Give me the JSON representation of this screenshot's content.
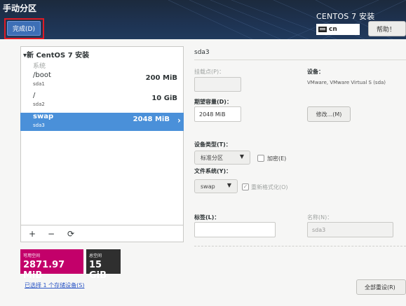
{
  "header": {
    "title": "手动分区",
    "done_label": "完成(D)",
    "product": "CENTOS 7 安装",
    "keyboard": "cn",
    "help_label": "帮助！"
  },
  "left": {
    "install_heading": "新 CentOS 7 安装",
    "group_label": "系统",
    "mounts": [
      {
        "name": "/boot",
        "device": "sda1",
        "size": "200 MiB"
      },
      {
        "name": "/",
        "device": "sda2",
        "size": "10 GiB"
      },
      {
        "name": "swap",
        "device": "sda3",
        "size": "2048 MiB"
      }
    ],
    "selected_index": 2,
    "toolbar": {
      "add": "+",
      "remove": "−",
      "refresh": "⟳"
    },
    "available": {
      "label": "可用空间",
      "value": "2871.97 MiB"
    },
    "total": {
      "label": "总空间",
      "value": "15 GiB"
    },
    "storage_link": "已选择 1 个存储设备(S)"
  },
  "detail": {
    "title": "sda3",
    "mount_point_label": "挂载点(P)：",
    "mount_point_value": "",
    "desired_capacity_label": "期望容量(D)：",
    "desired_capacity_value": "2048 MiB",
    "device_label": "设备：",
    "device_info": "VMware, VMware Virtual S (sda)",
    "modify_label": "修改...(M)",
    "device_type_label": "设备类型(T)：",
    "device_type_value": "标准分区",
    "encrypt_label": "加密(E)",
    "filesystem_label": "文件系统(Y)：",
    "filesystem_value": "swap",
    "reformat_label": "重新格式化(O)",
    "tag_label": "标签(L)：",
    "tag_value": "",
    "name_label": "名称(N)：",
    "name_value": "sda3",
    "reset_label": "全部重设(R)"
  },
  "colors": {
    "accent": "#4a90d9",
    "available": "#c3006a",
    "total": "#2f2f2f",
    "highlight": "#e01b24"
  }
}
